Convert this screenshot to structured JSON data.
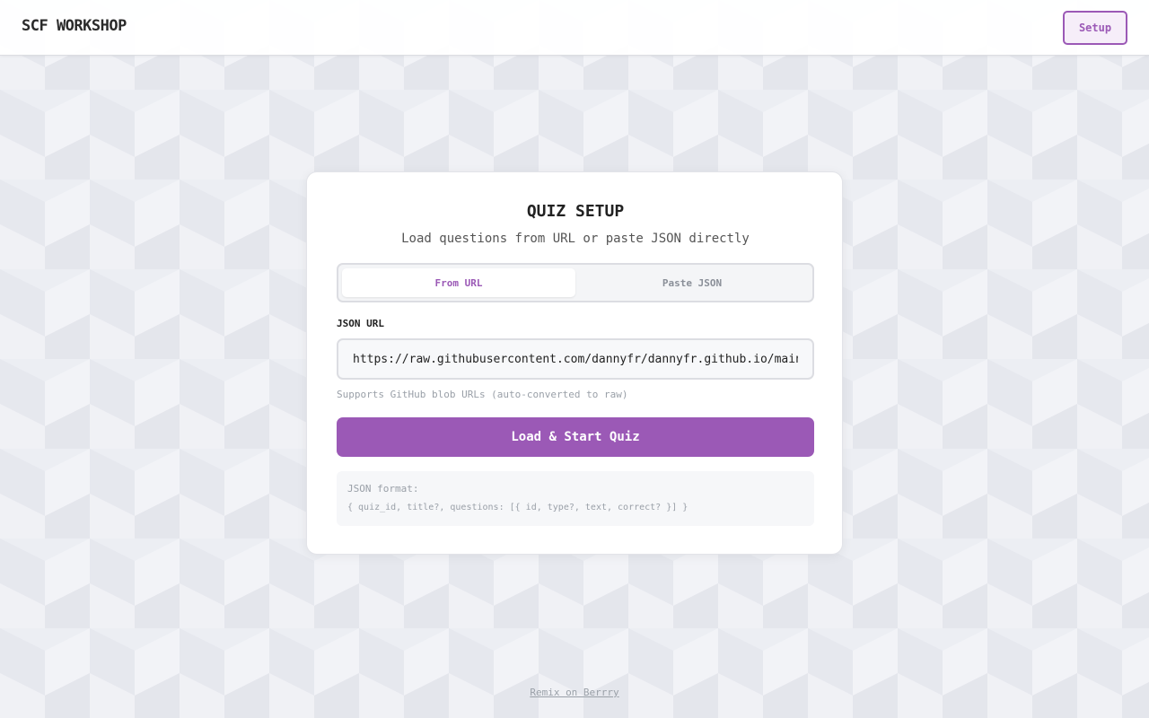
{
  "header": {
    "brand": "SCF WORKSHOP",
    "setup_label": "Setup"
  },
  "card": {
    "title": "QUIZ SETUP",
    "subtitle": "Load questions from URL or paste JSON directly",
    "tabs": [
      {
        "label": "From URL",
        "active": true
      },
      {
        "label": "Paste JSON",
        "active": false
      }
    ],
    "url_label": "JSON URL",
    "url_value": "https://raw.githubusercontent.com/dannyfr/dannyfr.github.io/main/",
    "hint": "Supports GitHub blob URLs (auto-converted to raw)",
    "submit_label": "Load & Start Quiz",
    "format": {
      "heading": "JSON format:",
      "schema": "{ quiz_id, title?, questions: [{ id, type?, text, correct? }] }"
    }
  },
  "footer": {
    "link": "Remix on Berrry"
  },
  "colors": {
    "accent": "#9b59b6",
    "background": "#eceef3"
  }
}
